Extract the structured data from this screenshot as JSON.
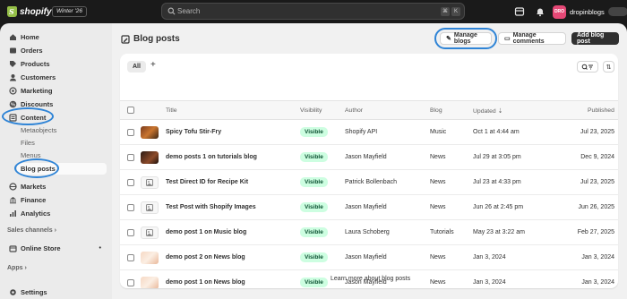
{
  "topbar": {
    "brand": "shopify",
    "version": "Winter '26",
    "search_placeholder": "Search",
    "kbd1": "⌘",
    "kbd2": "K",
    "store_initials": "DRO",
    "store_name": "dropinblogs"
  },
  "sidebar": {
    "items": [
      {
        "label": "Home",
        "icon": "home-icon"
      },
      {
        "label": "Orders",
        "icon": "orders-icon"
      },
      {
        "label": "Products",
        "icon": "tag-icon"
      },
      {
        "label": "Customers",
        "icon": "person-icon"
      },
      {
        "label": "Marketing",
        "icon": "target-icon"
      },
      {
        "label": "Discounts",
        "icon": "discount-icon"
      },
      {
        "label": "Content",
        "icon": "content-icon"
      }
    ],
    "content_sub": [
      "Metaobjects",
      "Files",
      "Menus",
      "Blog posts"
    ],
    "items2": [
      {
        "label": "Markets",
        "icon": "globe-icon"
      },
      {
        "label": "Finance",
        "icon": "bank-icon"
      },
      {
        "label": "Analytics",
        "icon": "chart-icon"
      }
    ],
    "sales_channels": "Sales channels",
    "online_store": "Online Store",
    "apps": "Apps",
    "settings": "Settings"
  },
  "page": {
    "title": "Blog posts",
    "manage_blogs": "Manage blogs",
    "manage_comments": "Manage comments",
    "add_blog_post": "Add blog post",
    "tab_all": "All",
    "tab_add": "+",
    "learn_more": "Learn more about blog posts"
  },
  "table": {
    "headers": {
      "title": "Title",
      "visibility": "Visibility",
      "author": "Author",
      "blog": "Blog",
      "updated": "Updated",
      "published": "Published"
    },
    "rows": [
      {
        "title": "Spicy Tofu Stir-Fry",
        "visibility": "Visible",
        "author": "Shopify API",
        "blog": "Music",
        "updated": "Oct 1 at 4:44 am",
        "published": "Jul 23, 2025",
        "thumb": "food"
      },
      {
        "title": "demo posts 1 on tutorials blog",
        "visibility": "Visible",
        "author": "Jason Mayfield",
        "blog": "News",
        "updated": "Jul 29 at 3:05 pm",
        "published": "Dec 9, 2024",
        "thumb": "dark"
      },
      {
        "title": "Test Direct ID for Recipe Kit",
        "visibility": "Visible",
        "author": "Patrick Bollenbach",
        "blog": "News",
        "updated": "Jul 23 at 4:33 pm",
        "published": "Jul 23, 2025",
        "thumb": "placeholder"
      },
      {
        "title": "Test Post with Shopify Images",
        "visibility": "Visible",
        "author": "Jason Mayfield",
        "blog": "News",
        "updated": "Jun 26 at 2:45 pm",
        "published": "Jun 26, 2025",
        "thumb": "placeholder"
      },
      {
        "title": "demo post 1 on Music blog",
        "visibility": "Visible",
        "author": "Laura Schoberg",
        "blog": "Tutorials",
        "updated": "May 23 at 3:22 am",
        "published": "Feb 27, 2025",
        "thumb": "placeholder"
      },
      {
        "title": "demo post 2 on News blog",
        "visibility": "Visible",
        "author": "Jason Mayfield",
        "blog": "News",
        "updated": "Jan 3, 2024",
        "published": "Jan 3, 2024",
        "thumb": "light"
      },
      {
        "title": "demo post 1 on News blog",
        "visibility": "Visible",
        "author": "Jason Mayfield",
        "blog": "News",
        "updated": "Jan 3, 2024",
        "published": "Jan 3, 2024",
        "thumb": "light"
      }
    ]
  },
  "colors": {
    "accent_ring": "#2f84d6",
    "visible_badge_bg": "#cdfee1",
    "visible_badge_text": "#0c5132"
  }
}
